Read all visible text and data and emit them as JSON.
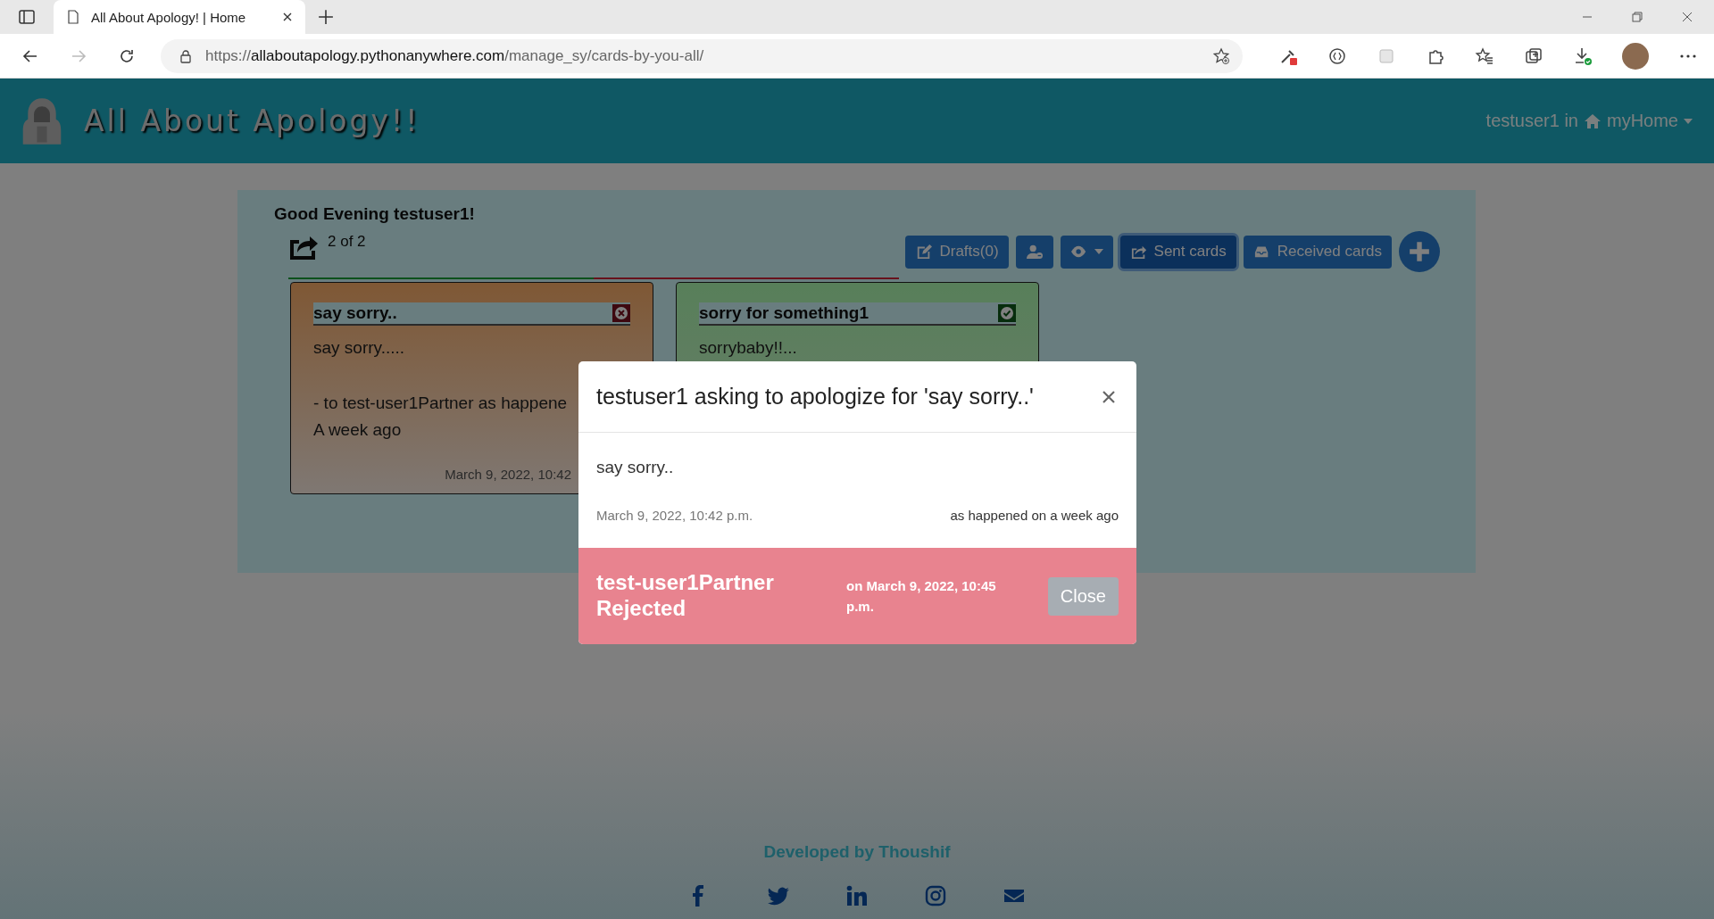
{
  "browser": {
    "tabs": [
      {
        "title": "All About Apology! | Home",
        "selected": true
      }
    ],
    "url": {
      "scheme": "https://",
      "host": "allaboutapology.pythonanywhere.com",
      "path": "/manage_sy/cards-by-you-all/"
    }
  },
  "header": {
    "brand": "All About Apology!!",
    "user": "testuser1",
    "joiner": "in",
    "home": "myHome"
  },
  "panel": {
    "greeting": "Good Evening testuser1!",
    "counter": "2 of 2",
    "toolbar": [
      {
        "kind": "drafts",
        "label": "Drafts(0)",
        "selected": false
      },
      {
        "kind": "user",
        "selected": false
      },
      {
        "kind": "view",
        "selected": false
      },
      {
        "kind": "sent",
        "label": "Sent cards",
        "selected": true
      },
      {
        "kind": "received",
        "label": "Received cards",
        "selected": false
      },
      {
        "kind": "add",
        "selected": false
      }
    ],
    "cards": [
      {
        "kind": "rejected",
        "title": "say sorry..",
        "body": "say sorry.....",
        "recipient": "- to test-user1Partner as happene",
        "when": "A week ago",
        "date": "March 9, 2022, 10:42"
      },
      {
        "kind": "accepted",
        "title": "sorry for something1",
        "body": "sorrybaby!!..."
      }
    ]
  },
  "modal": {
    "title": "testuser1 asking to apologize for 'say sorry..'",
    "message": "say sorry..",
    "date": "March 9, 2022, 10:42 p.m.",
    "happened": "as happened on a week ago",
    "kind": "rejected",
    "response": "test-user1Partner Rejected",
    "response_date": "on March 9, 2022, 10:45 p.m.",
    "close": "Close"
  },
  "footer": {
    "credit": "Developed by Thoushif",
    "socials": [
      {
        "kind": "facebook"
      },
      {
        "kind": "twitter"
      },
      {
        "kind": "linkedin"
      },
      {
        "kind": "instagram"
      },
      {
        "kind": "mail"
      }
    ]
  }
}
